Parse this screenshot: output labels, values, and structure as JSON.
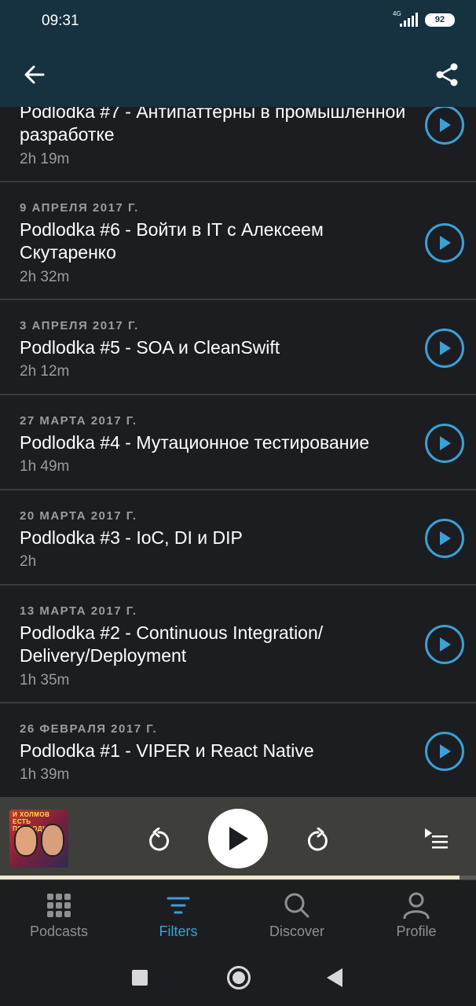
{
  "status_bar": {
    "time": "09:31",
    "network": "4G",
    "battery": "92"
  },
  "app_bar": {
    "back_icon": "arrow-left-icon",
    "share_icon": "share-icon"
  },
  "episodes": [
    {
      "date": "",
      "title": "Podlodka #7 - Антипаттерны в промышленной разработке",
      "duration": "2h 19m"
    },
    {
      "date": "9 АПРЕЛЯ 2017 Г.",
      "title": "Podlodka #6 - Войти в IT с Алексеем Скутаренко",
      "duration": "2h 32m"
    },
    {
      "date": "3 АПРЕЛЯ 2017 Г.",
      "title": "Podlodka #5 - SOA и CleanSwift",
      "duration": "2h 12m"
    },
    {
      "date": "27 МАРТА 2017 Г.",
      "title": "Podlodka #4 - Мутационное тестирование",
      "duration": "1h 49m"
    },
    {
      "date": "20 МАРТА 2017 Г.",
      "title": "Podlodka #3 - IoC, DI и DIP",
      "duration": "2h"
    },
    {
      "date": "13 МАРТА 2017 Г.",
      "title": "Podlodka #2 - Continuous Integration/ Delivery/Deployment",
      "duration": "1h 35m"
    },
    {
      "date": "26 ФЕВРАЛЯ 2017 Г.",
      "title": "Podlodka #1 - VIPER и React Native",
      "duration": "1h 39m"
    }
  ],
  "player": {
    "artwork_text": "И ХОЛМОВ ЕСТЬ ПОДЛОДКИ",
    "progress_fraction": 0.965,
    "accent": "#3aa0d6"
  },
  "tabs": [
    {
      "label": "Podcasts",
      "icon": "grid-icon",
      "active": false
    },
    {
      "label": "Filters",
      "icon": "filter-icon",
      "active": true
    },
    {
      "label": "Discover",
      "icon": "search-icon",
      "active": false
    },
    {
      "label": "Profile",
      "icon": "person-icon",
      "active": false
    }
  ]
}
